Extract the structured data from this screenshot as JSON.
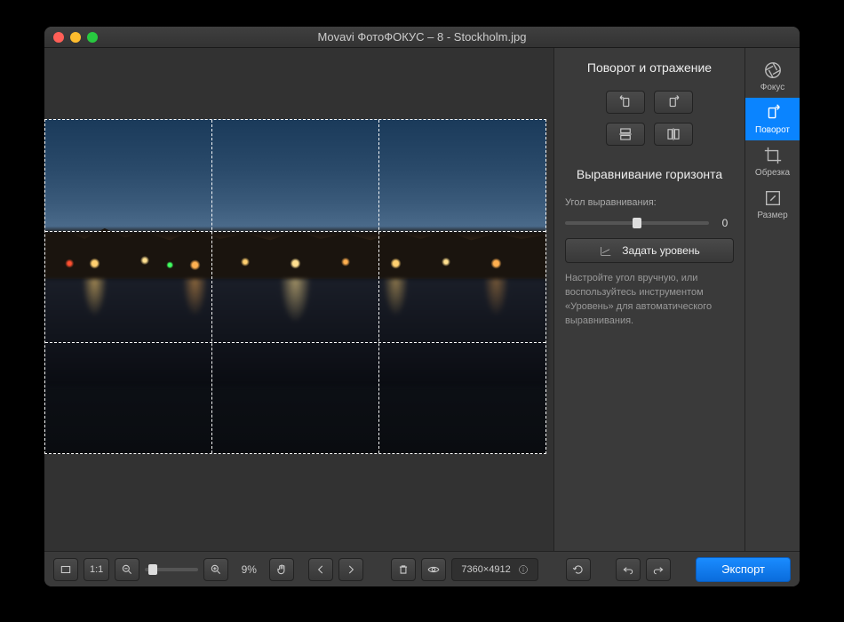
{
  "window": {
    "title": "Movavi ФотоФОКУС – 8 - Stockholm.jpg"
  },
  "tools": {
    "focus": {
      "label": "Фокус"
    },
    "rotate": {
      "label": "Поворот"
    },
    "crop": {
      "label": "Обрезка"
    },
    "resize": {
      "label": "Размер"
    }
  },
  "panel": {
    "rotate_title": "Поворот и отражение",
    "level_title": "Выравнивание горизонта",
    "angle_label": "Угол выравнивания:",
    "angle_value": "0",
    "set_level": "Задать уровень",
    "hint": "Настройте угол вручную, или воспользуйтесь инструментом «Уровень» для автоматического выравнивания."
  },
  "bottom": {
    "fit_label": "1:1",
    "zoom_pct": "9%",
    "dimensions": "7360×4912",
    "export": "Экспорт"
  },
  "slider": {
    "angle_pos_pct": 50
  }
}
